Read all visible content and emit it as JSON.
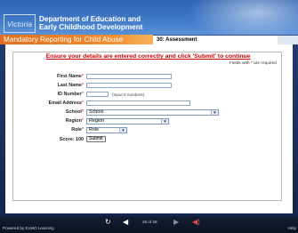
{
  "header": {
    "logo": "Victoria",
    "department_line1": "Department of Education and",
    "department_line2": "Early Childhood Development"
  },
  "bar": {
    "title": "Mandatory Reporting for Child Abuse",
    "step": "30: Assessment"
  },
  "form": {
    "notice": "Ensure your details are entered correctly and click 'Submit' to continue",
    "required_text": "Fields with",
    "required_star": "*",
    "required_suffix": "are required",
    "fields": {
      "first_name_label": "First Name",
      "last_name_label": "Last Name",
      "id_number_label": "ID Number",
      "id_number_hint": "(Input 8 numbers)",
      "email_label": "Email Address",
      "school_label": "School",
      "school_value": "School",
      "region_label": "Region",
      "region_value": "Region",
      "role_label": "Role",
      "role_value": "Role",
      "score_label": "Score: 100",
      "submit_label": "Submit"
    }
  },
  "footer": {
    "powered": "Powered by ELMO Learning",
    "page_indicator": "29 of 29",
    "help": "Help"
  },
  "colors": {
    "accent_orange": "#ef8b2e",
    "notice_red": "#cc0000",
    "header_blue": "#3f78c6"
  }
}
